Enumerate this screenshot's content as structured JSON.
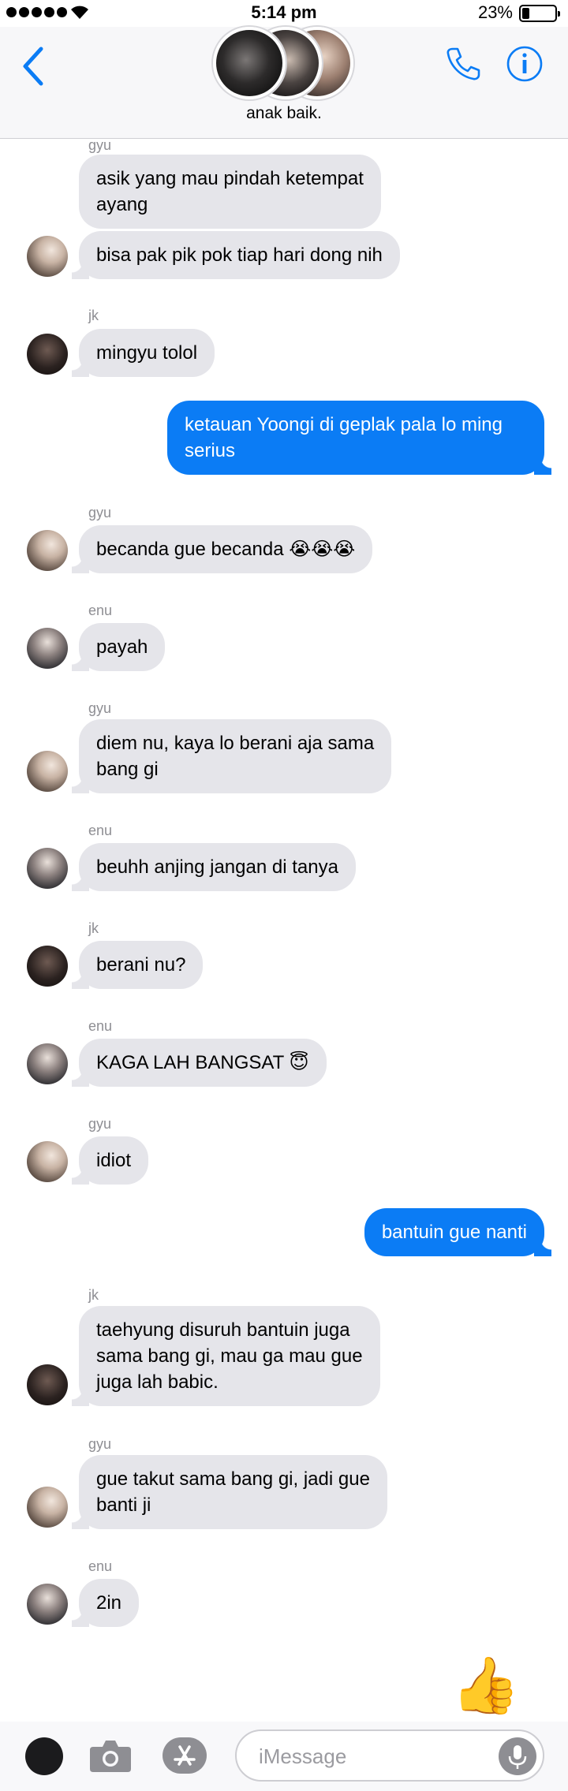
{
  "status_bar": {
    "time": "5:14 pm",
    "battery": "23%"
  },
  "header": {
    "group_name": "anak baik.",
    "icons": [
      "chevron-left-icon",
      "phone-icon",
      "info-icon"
    ]
  },
  "messages": [
    {
      "sender": "gyu",
      "text_lines": [
        "asik yang mau pindah ketempat",
        "ayang"
      ]
    },
    {
      "text": "bisa pak pik pok tiap hari dong nih"
    },
    {
      "sender": "jk",
      "text": "mingyu tolol"
    },
    {
      "text_lines": [
        "ketauan Yoongi di geplak pala lo ming",
        "serius"
      ]
    },
    {
      "sender": "gyu",
      "text": "becanda gue becanda 😭😭😭"
    },
    {
      "sender": "enu",
      "text": "payah"
    },
    {
      "sender": "gyu",
      "text_lines": [
        "diem nu, kaya lo berani aja sama",
        "bang gi"
      ]
    },
    {
      "sender": "enu",
      "text": "beuhh anjing jangan di tanya"
    },
    {
      "sender": "jk",
      "text": "berani nu?"
    },
    {
      "sender": "enu",
      "text": "KAGA LAH BANGSAT 😇"
    },
    {
      "sender": "gyu",
      "text": "idiot"
    },
    {
      "text": "bantuin gue nanti"
    },
    {
      "sender": "jk",
      "text_lines": [
        "taehyung disuruh bantuin juga",
        "sama bang gi, mau ga mau gue",
        "juga lah babic."
      ]
    },
    {
      "sender": "gyu",
      "text_lines": [
        "gue takut sama bang gi, jadi gue",
        "banti ji"
      ]
    },
    {
      "sender": "enu",
      "text": "2in"
    }
  ],
  "sticker": "👍",
  "composer": {
    "placeholder": "iMessage",
    "value": ""
  },
  "colors": {
    "accent": "#0b7cf5",
    "incoming_bubble": "#e5e5ea",
    "sender_label": "#8e8e93"
  }
}
